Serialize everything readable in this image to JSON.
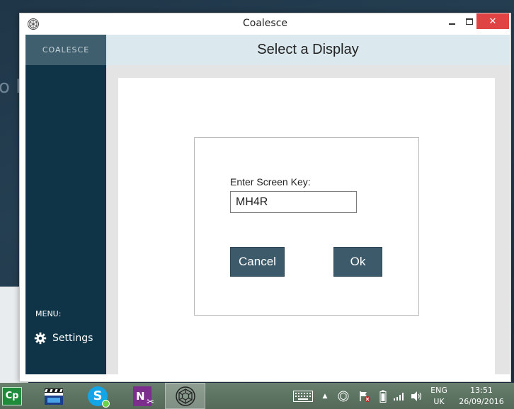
{
  "window": {
    "title": "Coalesce"
  },
  "sidebar": {
    "brand": "COALESCE",
    "menu_label": "MENU:",
    "settings_label": "Settings",
    "settings_icon": "gear-icon"
  },
  "header": {
    "title": "Select a Display"
  },
  "dialog": {
    "label": "Enter Screen Key:",
    "screen_key_value": "MH4R",
    "cancel_label": "Cancel",
    "ok_label": "Ok"
  },
  "taskbar": {
    "apps": [
      {
        "name": "captivate",
        "icon": "cp-icon",
        "label": "Cp"
      },
      {
        "name": "movie-maker",
        "icon": "film-clapper-icon"
      },
      {
        "name": "skype",
        "icon": "skype-icon",
        "label": "S"
      },
      {
        "name": "onenote",
        "icon": "onenote-icon",
        "label": "N"
      },
      {
        "name": "coalesce",
        "icon": "coalesce-icon",
        "active": true
      }
    ],
    "language": "ENG",
    "region": "UK",
    "time": "13:51",
    "date": "26/09/2016"
  },
  "colors": {
    "sidebar": "#0f3447",
    "header": "#dbe9ee",
    "button": "#3d5a6b",
    "close": "#e04343"
  }
}
